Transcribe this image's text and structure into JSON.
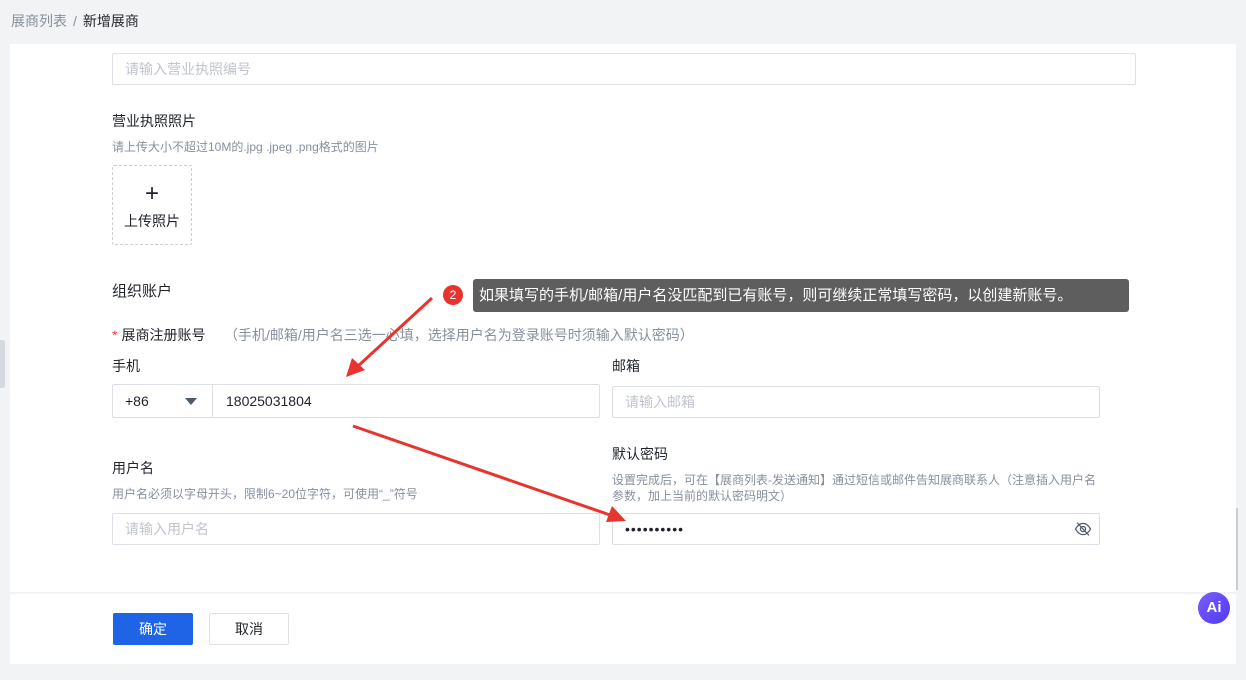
{
  "breadcrumb": {
    "prev": "展商列表",
    "separator": "/",
    "current": "新增展商"
  },
  "form": {
    "license_number": {
      "placeholder": "请输入营业执照编号"
    },
    "license_photo": {
      "label": "营业执照照片",
      "hint": "请上传大小不超过10M的.jpg .jpeg .png格式的图片",
      "upload_plus": "+",
      "upload_label": "上传照片"
    },
    "section_title": "组织账户",
    "register_account": {
      "required_mark": "*",
      "label": "展商注册账号",
      "hint": "（手机/邮箱/用户名三选一必填，选择用户名为登录账号时须输入默认密码）"
    },
    "phone": {
      "label": "手机",
      "country_code": "+86",
      "value": "18025031804"
    },
    "email": {
      "label": "邮箱",
      "placeholder": "请输入邮箱"
    },
    "username": {
      "label": "用户名",
      "hint": "用户名必须以字母开头，限制6~20位字符，可使用“_”符号",
      "placeholder": "请输入用户名"
    },
    "password": {
      "label": "默认密码",
      "hint_line1": "设置完成后，可在【展商列表-发送通知】通过短信或邮件告知展商联系人（注意插入用户名",
      "hint_line2": "参数，加上当前的默认密码明文）",
      "value": "••••••••••",
      "toggle_icon": "eye-off-icon"
    }
  },
  "buttons": {
    "confirm": "确定",
    "cancel": "取消"
  },
  "annotation": {
    "number": "2",
    "text": "如果填写的手机/邮箱/用户名没匹配到已有账号，则可继续正常填写密码，以创建新账号。",
    "arrow_color": "#e8342e"
  },
  "ai_badge": {
    "label": "Ai"
  },
  "colors": {
    "primary": "#1f64e6",
    "required": "#f53f3f",
    "tooltip_bg": "#5e5e5e"
  }
}
